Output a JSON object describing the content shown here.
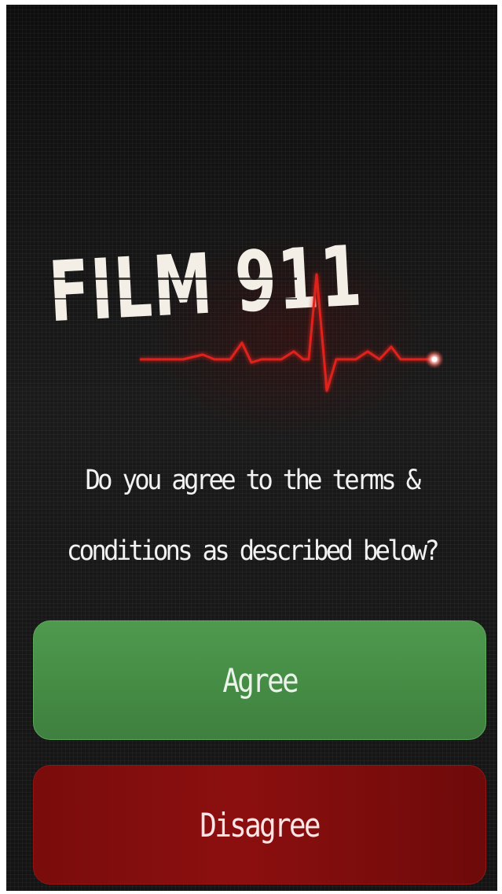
{
  "logo": {
    "text": "FILM 911",
    "heartbeat_color": "#e0241b"
  },
  "prompt": {
    "line1": "Do you agree to the terms &",
    "line2": "conditions as described below?"
  },
  "buttons": {
    "agree_label": "Agree",
    "disagree_label": "Disagree"
  },
  "colors": {
    "background": "#161616",
    "agree": "#4a924a",
    "disagree": "#860e0e",
    "text": "#f2f2f2"
  }
}
